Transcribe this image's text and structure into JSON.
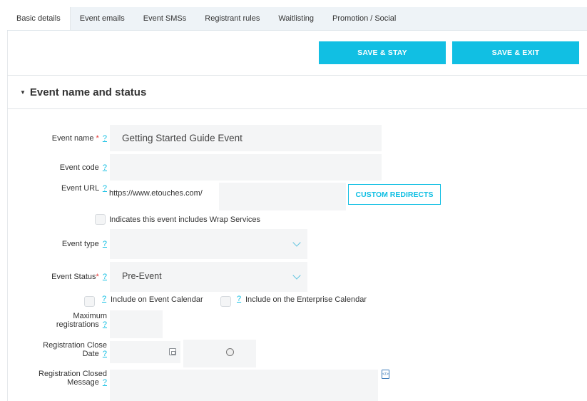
{
  "tabs": [
    {
      "label": "Basic details",
      "active": true
    },
    {
      "label": "Event emails",
      "active": false
    },
    {
      "label": "Event SMSs",
      "active": false
    },
    {
      "label": "Registrant rules",
      "active": false
    },
    {
      "label": "Waitlisting",
      "active": false
    },
    {
      "label": "Promotion / Social",
      "active": false
    }
  ],
  "toolbar": {
    "save_stay": "SAVE & STAY",
    "save_exit": "SAVE & EXIT"
  },
  "section": {
    "title": "Event name and status"
  },
  "help": "?",
  "required_mark": "*",
  "form": {
    "event_name": {
      "label": "Event name",
      "value": "Getting Started Guide Event"
    },
    "event_code": {
      "label": "Event code",
      "value": ""
    },
    "event_url": {
      "label": "Event URL",
      "prefix": "https://www.etouches.com/",
      "value": "",
      "custom_redirects": "CUSTOM REDIRECTS"
    },
    "wrap_services": {
      "label": "Indicates this event includes Wrap Services",
      "checked": false
    },
    "event_type": {
      "label": "Event type",
      "value": ""
    },
    "event_status": {
      "label": "Event Status",
      "value": "Pre-Event"
    },
    "include_event_calendar": {
      "label": "Include on Event Calendar",
      "checked": false
    },
    "include_enterprise_calendar": {
      "label": "Include on the Enterprise Calendar",
      "checked": false
    },
    "max_registrations": {
      "label_line1": "Maximum",
      "label_line2": "registrations",
      "value": ""
    },
    "reg_close_date": {
      "label_line1": "Registration Close",
      "label_line2": "Date",
      "date": "",
      "time": ""
    },
    "reg_closed_message": {
      "label_line1": "Registration Closed",
      "label_line2": "Message",
      "value": ""
    }
  },
  "colors": {
    "accent": "#11bfe3",
    "required": "#e53935",
    "field_bg": "#f4f5f6",
    "tab_bar_bg": "#eef3f7"
  },
  "icons": {
    "calendar": "calendar-icon",
    "clock": "clock-icon",
    "document": "document-source-icon",
    "section_toggle": "caret-down-icon",
    "dropdown": "chevron-down-icon"
  }
}
